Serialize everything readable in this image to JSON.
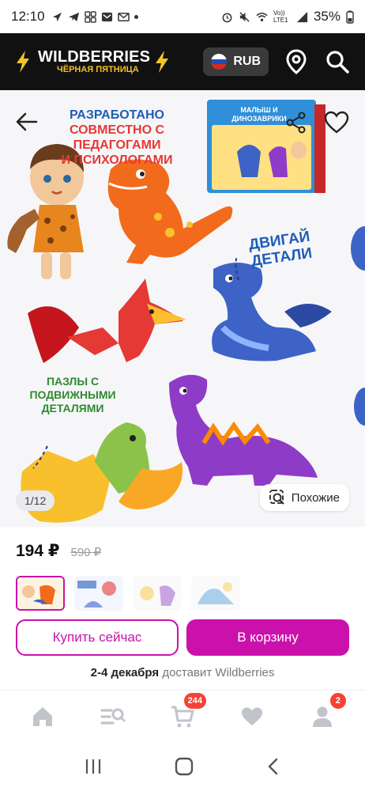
{
  "status_bar": {
    "time": "12:10",
    "battery": "35%",
    "network_label": "Vo)) LTE1"
  },
  "header": {
    "brand": "WILDBERRIES",
    "promo": "ЧЁРНАЯ ПЯТНИЦА",
    "currency": "RUB"
  },
  "gallery": {
    "headline": "РАЗРАБОТАНО СОВМЕСТНО С ПЕДАГОГАМИ И ПСИХОЛОГАМИ",
    "headline_line1": "РАЗРАБОТАНО",
    "headline_line2": "СОВМЕСТНО С ПЕДАГОГАМИ",
    "headline_line3": "И ПСИХОЛОГАМИ",
    "move_parts_line1": "ДВИГАЙ",
    "move_parts_line2": "ДЕТАЛИ",
    "puzzles_line1": "ПАЗЛЫ С",
    "puzzles_line2": "ПОДВИЖНЫМИ",
    "puzzles_line3": "ДЕТАЛЯМИ",
    "box_title_line1": "МАЛЫШ И",
    "box_title_line2": "ДИНОЗАВРИКИ",
    "counter": "1/12",
    "similar_label": "Похожие"
  },
  "product": {
    "price": "194 ₽",
    "old_price": "590 ₽"
  },
  "actions": {
    "buy_now": "Купить сейчас",
    "add_to_cart": "В корзину"
  },
  "delivery": {
    "date": "2-4 декабря",
    "text": "доставит Wildberries"
  },
  "bottom_nav": {
    "cart_count": "244",
    "profile_count": "2"
  },
  "colors": {
    "accent": "#cb11ab",
    "header_bg": "#111111",
    "promo_yellow": "#f4c22b",
    "badge_red": "#f44336"
  }
}
